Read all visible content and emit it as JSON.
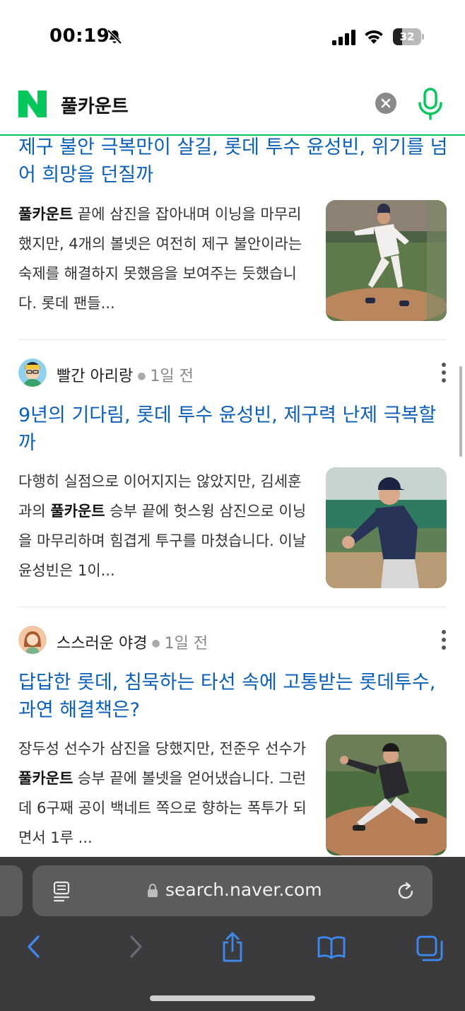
{
  "status_bar": {
    "time": "00:19",
    "battery_level": "32",
    "icons": [
      "bell-slash-icon",
      "cellular-signal-icon",
      "wifi-icon",
      "battery-icon"
    ]
  },
  "search": {
    "logo": "N",
    "query": "풀카운트",
    "icons": [
      "naver-logo-icon",
      "clear-icon",
      "microphone-icon"
    ],
    "accent_color": "#03c75a"
  },
  "results": [
    {
      "title": "제구 불안 극복만이 살길, 롯데 투수 윤성빈, 위기를 넘어 희망을 던질까",
      "snippet_highlight": "풀카운트",
      "snippet_rest": " 끝에 삼진을 잡아내며 이닝을 마무리했지만, 4개의 볼넷은 여전히 제구 불안이라는 숙제를 해결하지 못했음을 보여주는 듯했습니다. 롯데 팬들...",
      "thumbnail": "baseball-pitcher-photo"
    },
    {
      "source": "빨간 아리랑",
      "time": "1일 전",
      "title": "9년의 기다림, 롯데 투수 윤성빈, 제구력 난제 극복할까",
      "snippet_before": "다행히 실점으로 이어지지는 않았지만, 김세훈과의 ",
      "snippet_highlight": "풀카운트",
      "snippet_after": " 승부 끝에 헛스윙 삼진으로 이닝을 마무리하며 힘겹게 투구를 마쳤습니다. 이날 윤성빈은 1이...",
      "thumbnail": "baseball-pitcher-photo"
    },
    {
      "source": "스스러운 야경",
      "time": "1일 전",
      "title": "답답한 롯데, 침묵하는 타선 속에 고통받는 롯데투수, 과연 해결책은?",
      "snippet_before": "장두성 선수가 삼진을 당했지만, 전준우 선수가 ",
      "snippet_highlight": "풀카운트",
      "snippet_after": " 승부 끝에 볼넷을 얻어냈습니다. 그런데 6구째 공이 백네트 쪽으로 향하는 폭투가 되면서 1루 ...",
      "thumbnail": "baseball-pitcher-photo"
    }
  ],
  "colors": {
    "title_link": "#0b5fb8",
    "safari_toolbar": "#3b3b3d",
    "safari_tint": "#3d8bf2"
  },
  "browser": {
    "url": "search.naver.com",
    "icons": [
      "reader-icon",
      "lock-icon",
      "reload-icon"
    ],
    "toolbar": [
      "back-icon",
      "forward-icon",
      "share-icon",
      "bookmarks-icon",
      "tabs-icon"
    ]
  }
}
